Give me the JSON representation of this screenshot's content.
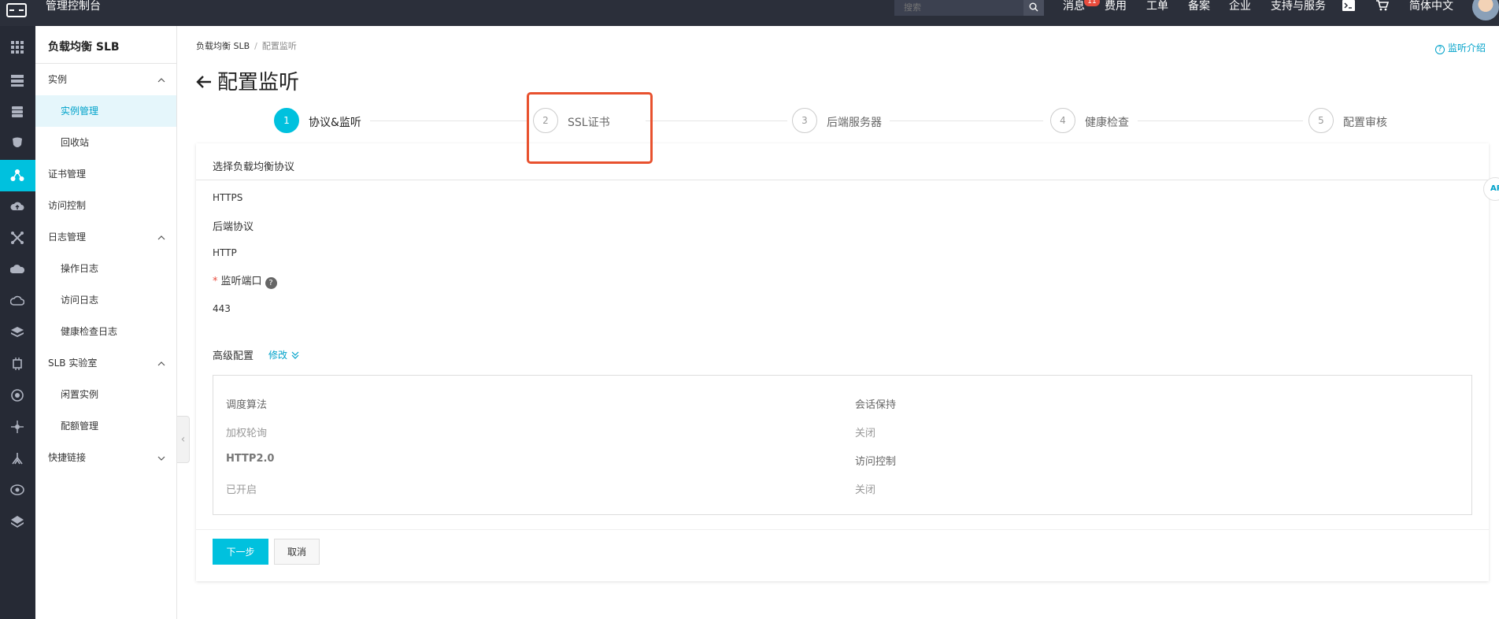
{
  "topbar": {
    "console_title": "管理控制台",
    "search_placeholder": "搜索",
    "nav": {
      "messages": "消息",
      "messages_badge": "11",
      "fees": "费用",
      "tickets": "工单",
      "filing": "备案",
      "enterprise": "企业",
      "support": "支持与服务",
      "language": "简体中文"
    },
    "icons": [
      "console-logo-icon",
      "search-icon",
      "terminal-icon",
      "cart-icon"
    ]
  },
  "rail": {
    "icons": [
      "grid-apps-icon",
      "server-list-icon",
      "storage-icon",
      "security-icon",
      "slb-network-icon",
      "cloud-upload-icon",
      "network-cross-icon",
      "cloud-gear-icon",
      "cloud-outline-icon",
      "stack-icon",
      "chip-icon",
      "eye-icon",
      "hub-icon",
      "cluster-icon",
      "target-icon",
      "layers-icon"
    ],
    "active_icon": "slb-network-icon"
  },
  "sidebar": {
    "title": "负载均衡 SLB",
    "items": [
      {
        "label": "实例",
        "type": "group",
        "expanded": true
      },
      {
        "label": "实例管理",
        "type": "sub",
        "active": true
      },
      {
        "label": "回收站",
        "type": "sub"
      },
      {
        "label": "证书管理",
        "type": "item"
      },
      {
        "label": "访问控制",
        "type": "item"
      },
      {
        "label": "日志管理",
        "type": "group",
        "expanded": true
      },
      {
        "label": "操作日志",
        "type": "sub"
      },
      {
        "label": "访问日志",
        "type": "sub"
      },
      {
        "label": "健康检查日志",
        "type": "sub"
      },
      {
        "label": "SLB 实验室",
        "type": "group",
        "expanded": true
      },
      {
        "label": "闲置实例",
        "type": "sub"
      },
      {
        "label": "配额管理",
        "type": "sub"
      },
      {
        "label": "快捷链接",
        "type": "group",
        "expanded": false
      }
    ]
  },
  "breadcrumb": {
    "root": "负载均衡 SLB",
    "separator": "/",
    "current": "配置监听"
  },
  "help_link": "监听介绍",
  "page_title": "配置监听",
  "steps": [
    {
      "number": "1",
      "label": "协议&监听",
      "active": true
    },
    {
      "number": "2",
      "label": "SSL证书",
      "active": false
    },
    {
      "number": "3",
      "label": "后端服务器",
      "active": false
    },
    {
      "number": "4",
      "label": "健康检查",
      "active": false
    },
    {
      "number": "5",
      "label": "配置审核",
      "active": false
    }
  ],
  "form": {
    "header": "选择负载均衡协议",
    "protocol_value": "HTTPS",
    "backend_protocol_label": "后端协议",
    "backend_protocol_value": "HTTP",
    "port_required_mark": "*",
    "port_label": "监听端口",
    "port_help": "?",
    "port_value": "443",
    "advanced": {
      "title": "高级配置",
      "edit_label": "修改",
      "rows": [
        {
          "label": "调度算法",
          "value": "加权轮询"
        },
        {
          "label": "会话保持",
          "value": "关闭"
        },
        {
          "label": "HTTP2.0",
          "value": "已开启"
        },
        {
          "label": "访问控制",
          "value": "关闭"
        }
      ]
    },
    "next_button": "下一步",
    "cancel_button": "取消"
  },
  "side_float_label": "AP",
  "colors": {
    "accent": "#00c1de",
    "link": "#00a2ca",
    "topbar_bg": "#2b2f3a",
    "rail_bg": "#262a35",
    "highlight": "#e8512e",
    "badge": "#e84c3d"
  }
}
